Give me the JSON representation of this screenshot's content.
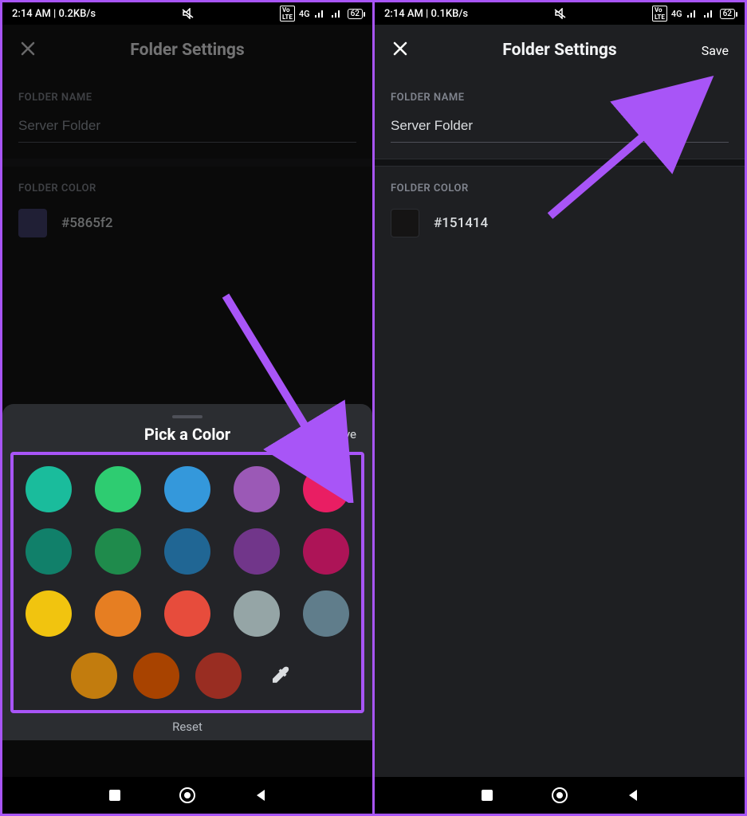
{
  "left": {
    "status": {
      "time_net": "2:14 AM | 0.2KB/s",
      "net_label": "4G",
      "battery": "62"
    },
    "header": {
      "title": "Folder Settings"
    },
    "folder_name": {
      "label": "FOLDER NAME",
      "value": "Server Folder"
    },
    "folder_color": {
      "label": "FOLDER COLOR",
      "hex": "#5865f2",
      "swatch": "#3b3a6b"
    },
    "sheet": {
      "title": "Pick a Color",
      "save": "Save",
      "reset": "Reset",
      "colors_row1": [
        "#1abc9c",
        "#2ecc71",
        "#3498db",
        "#9b59b6",
        "#e91e63"
      ],
      "colors_row2": [
        "#11806a",
        "#1f8b4c",
        "#206694",
        "#71368a",
        "#ad1457"
      ],
      "colors_row3": [
        "#f1c40f",
        "#e67e22",
        "#e74c3c",
        "#95a5a6",
        "#607d8b"
      ],
      "colors_row4": [
        "#c27c0e",
        "#a84300",
        "#992d22"
      ]
    }
  },
  "right": {
    "status": {
      "time_net": "2:14 AM | 0.1KB/s",
      "net_label": "4G",
      "battery": "62"
    },
    "header": {
      "title": "Folder Settings",
      "save": "Save"
    },
    "folder_name": {
      "label": "FOLDER NAME",
      "value": "Server Folder"
    },
    "folder_color": {
      "label": "FOLDER COLOR",
      "hex": "#151414",
      "swatch": "#151414"
    }
  }
}
